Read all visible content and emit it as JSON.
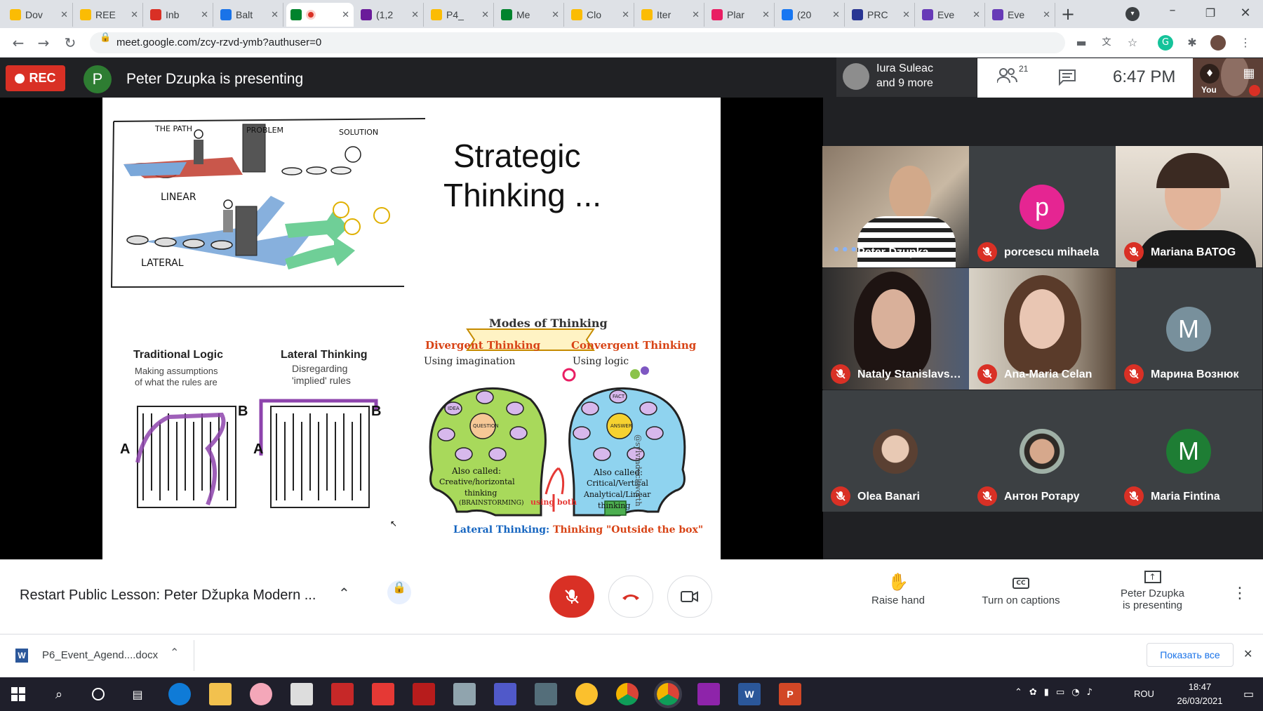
{
  "browser": {
    "tabs": [
      {
        "title": "Dov",
        "favicon": "drive-icon",
        "color": "#fbbc04"
      },
      {
        "title": "REE",
        "favicon": "drive-icon",
        "color": "#fbbc04"
      },
      {
        "title": "Inb",
        "favicon": "gmail-icon",
        "color": "#d93025"
      },
      {
        "title": "Balt",
        "favicon": "calendar-icon",
        "color": "#1a73e8"
      },
      {
        "title": "",
        "favicon": "meet-icon",
        "color": "#00832d",
        "active": true
      },
      {
        "title": "(1,2",
        "favicon": "mail-icon",
        "color": "#6a1b9a"
      },
      {
        "title": "P4_",
        "favicon": "drive-icon",
        "color": "#fbbc04"
      },
      {
        "title": "Me",
        "favicon": "meet-icon",
        "color": "#00832d"
      },
      {
        "title": "Clo",
        "favicon": "drive-icon",
        "color": "#fbbc04"
      },
      {
        "title": "Iter",
        "favicon": "drive-icon",
        "color": "#fbbc04"
      },
      {
        "title": "Plar",
        "favicon": "slides-icon",
        "color": "#e91e63"
      },
      {
        "title": "(20",
        "favicon": "facebook-icon",
        "color": "#1877f2"
      },
      {
        "title": "PRC",
        "favicon": "prc-icon",
        "color": "#283593"
      },
      {
        "title": "Eve",
        "favicon": "forms-icon",
        "color": "#673ab7"
      },
      {
        "title": "Eve",
        "favicon": "forms-icon",
        "color": "#673ab7"
      }
    ],
    "url": "meet.google.com/zcy-rzvd-ymb?authuser=0"
  },
  "meet": {
    "rec_label": "REC",
    "presenter_initial": "P",
    "presenting_text": "Peter Dzupka is presenting",
    "others_name": "Iura Suleac",
    "others_more": "and 9 more",
    "participant_count": "21",
    "time": "6:47 PM",
    "you_label": "You",
    "colors": {
      "rec": "#d93025",
      "bg": "#202124",
      "tile": "#3c4043"
    }
  },
  "slide": {
    "title_line1": "Strategic",
    "title_line2": "Thinking ...",
    "path_label": "THE PATH",
    "problem_label": "PROBLEM",
    "solution_label": "SOLUTION",
    "linear_label": "LINEAR",
    "lateral_label": "LATERAL",
    "traditional_title": "Traditional Logic",
    "traditional_sub1": "Making assumptions",
    "traditional_sub2": "of what the rules are",
    "lateral_title": "Lateral Thinking",
    "lateral_sub1": "Disregarding",
    "lateral_sub2": "'implied' rules",
    "maze_a": "A",
    "maze_b": "B",
    "modes_banner": "Modes of Thinking",
    "divergent_title": "Divergent Thinking",
    "divergent_sub": "Using imagination",
    "convergent_title": "Convergent Thinking",
    "convergent_sub": "Using logic",
    "idea": "IDEA",
    "question": "QUESTION",
    "fact": "FACT",
    "answer": "ANSWER",
    "div_also1": "Also called:",
    "div_also2": "Creative/horizontal",
    "div_also3": "thinking",
    "div_also4": "(BRAINSTORMING)",
    "conv_also1": "Also called:",
    "conv_also2": "Critical/Vertical",
    "conv_also3": "Analytical/Linear",
    "conv_also4": "thinking",
    "using_both": "using both",
    "credit": "@sylviaduckworth",
    "bottom_caption_a": "Lateral Thinking:",
    "bottom_caption_b": "Thinking \"Outside the box\""
  },
  "participants": [
    {
      "name": "Peter Dzupka",
      "type": "video",
      "speaking": true
    },
    {
      "name": "porcescu mihaela",
      "type": "letter",
      "letter": "p",
      "color": "#e52592"
    },
    {
      "name": "Mariana BATOG",
      "type": "video"
    },
    {
      "name": "Nataly Stanislavsk...",
      "type": "video"
    },
    {
      "name": "Ana-Maria Celan",
      "type": "video"
    },
    {
      "name": "Марина Вознюк",
      "type": "letter",
      "letter": "M",
      "color": "#78909c"
    },
    {
      "name": "Olea Banari",
      "type": "photo"
    },
    {
      "name": "Антон Ротару",
      "type": "photo"
    },
    {
      "name": "Maria Fintina",
      "type": "letter",
      "letter": "M",
      "color": "#1e7d34"
    }
  ],
  "bottom": {
    "meeting_title": "Restart Public Lesson: Peter Džupka Modern ...",
    "raise_hand": "Raise hand",
    "captions": "Turn on captions",
    "presenting_line1": "Peter Dzupka",
    "presenting_line2": "is presenting"
  },
  "downloads": {
    "file": "P6_Event_Agend....docx",
    "show_all": "Показать все"
  },
  "taskbar": {
    "lang": "ROU",
    "time": "18:47",
    "date": "26/03/2021"
  }
}
